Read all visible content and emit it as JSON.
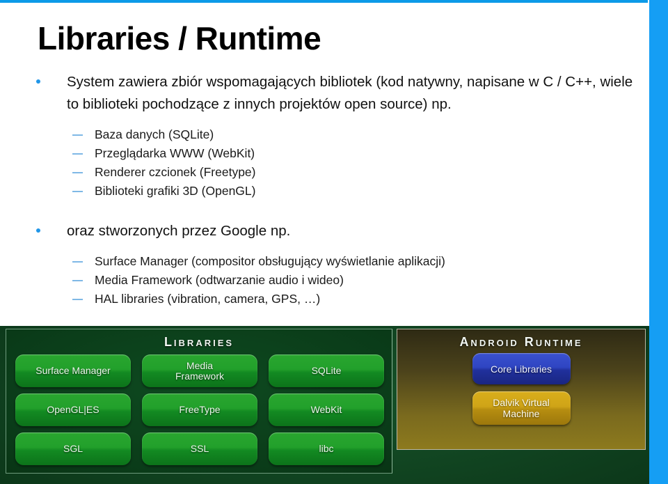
{
  "slide": {
    "title": "Libraries / Runtime",
    "accent_blue": "#159ef4",
    "bullet_dot_color": "#2196e8",
    "bullet_dash_color": "#7fb8e6"
  },
  "bullets": [
    {
      "level": 1,
      "text": "System zawiera zbiór wspomagających bibliotek (kod natywny, napisane w C / C++, wiele to biblioteki pochodzące z innych projektów open source) np."
    },
    {
      "level": 2,
      "text": "Baza danych (SQLite)"
    },
    {
      "level": 2,
      "text": "Przeglądarka WWW (WebKit)"
    },
    {
      "level": 2,
      "text": "Renderer czcionek (Freetype)"
    },
    {
      "level": 2,
      "text": "Biblioteki grafiki 3D (OpenGL)"
    },
    {
      "level": 1,
      "text": "oraz stworzonych przez Google np."
    },
    {
      "level": 2,
      "text": "Surface Manager (compositor obsługujący wyświetlanie aplikacji)"
    },
    {
      "level": 2,
      "text": "Media Framework (odtwarzanie audio i wideo)"
    },
    {
      "level": 2,
      "text": "HAL libraries (vibration, camera, GPS, …)"
    }
  ],
  "diagram": {
    "libraries_panel": {
      "heading": "Libraries",
      "buttons": [
        [
          "Surface Manager",
          "Media\nFramework",
          "SQLite"
        ],
        [
          "OpenGL|ES",
          "FreeType",
          "WebKit"
        ],
        [
          "SGL",
          "SSL",
          "libc"
        ]
      ],
      "button_color": "#22a02b",
      "panel_color": "#0a3a18"
    },
    "runtime_panel": {
      "heading": "Android Runtime",
      "core_libraries_label": "Core Libraries",
      "dalvik_label": "Dalvik Virtual\nMachine",
      "core_libraries_color": "#2f45c2",
      "dalvik_color": "#cfa417",
      "panel_color": "#7a6a1e"
    }
  }
}
